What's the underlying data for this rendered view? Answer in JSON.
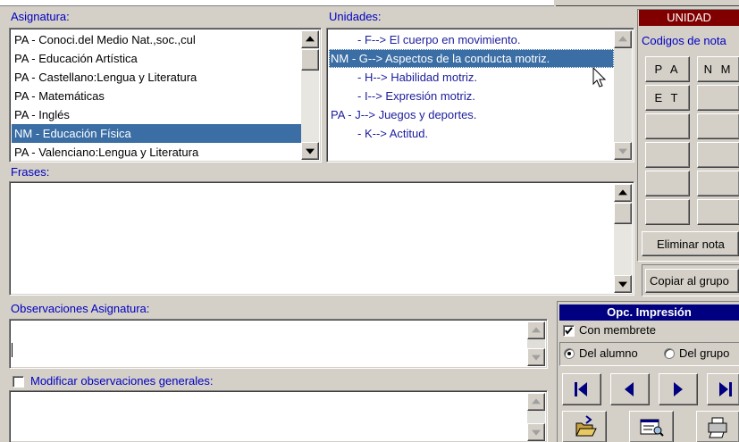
{
  "asignatura": {
    "label": "Asignatura:",
    "items": [
      {
        "text": "PA - Conoci.del Medio Nat.,soc.,cul",
        "selected": false
      },
      {
        "text": "PA - Educación Artística",
        "selected": false
      },
      {
        "text": "PA - Castellano:Lengua y Literatura",
        "selected": false
      },
      {
        "text": "PA - Matemáticas",
        "selected": false
      },
      {
        "text": "PA - Inglés",
        "selected": false
      },
      {
        "text": "NM - Educación Física",
        "selected": true
      },
      {
        "text": "PA - Valenciano:Lengua y Literatura",
        "selected": false
      }
    ]
  },
  "unidades": {
    "label": "Unidades:",
    "items": [
      {
        "text": "- F--> El cuerpo en movimiento.",
        "indent": true,
        "selected": false
      },
      {
        "text": "NM - G--> Aspectos de la conducta motriz.",
        "indent": false,
        "selected": true
      },
      {
        "text": "- H--> Habilidad motriz.",
        "indent": true,
        "selected": false
      },
      {
        "text": "- I--> Expresión motriz.",
        "indent": true,
        "selected": false
      },
      {
        "text": "PA - J--> Juegos y deportes.",
        "indent": false,
        "selected": false
      },
      {
        "text": "- K--> Actitud.",
        "indent": true,
        "selected": false
      }
    ]
  },
  "frases": {
    "label": "Frases:"
  },
  "observaciones": {
    "label": "Observaciones Asignatura:"
  },
  "modificar": {
    "label": "Modificar observaciones generales:",
    "checked": false
  },
  "notas": {
    "header": "UNIDAD",
    "codes_label": "Codigos de nota",
    "codes": [
      "P A",
      "N M",
      "E T",
      "",
      "",
      "",
      "",
      "",
      "",
      "",
      "",
      ""
    ],
    "eliminar": "Eliminar nota",
    "copiar": "Copiar al grupo"
  },
  "impresion": {
    "header": "Opc. Impresión",
    "membrete": "Con membrete",
    "membrete_checked": true,
    "del_alumno": "Del alumno",
    "del_grupo": "Del grupo",
    "selected_option": "alumno"
  },
  "colors": {
    "selection": "#3a6ea5",
    "label_blue": "#0000c0",
    "unidad_header": "#800000",
    "impresion_header": "#000080"
  }
}
